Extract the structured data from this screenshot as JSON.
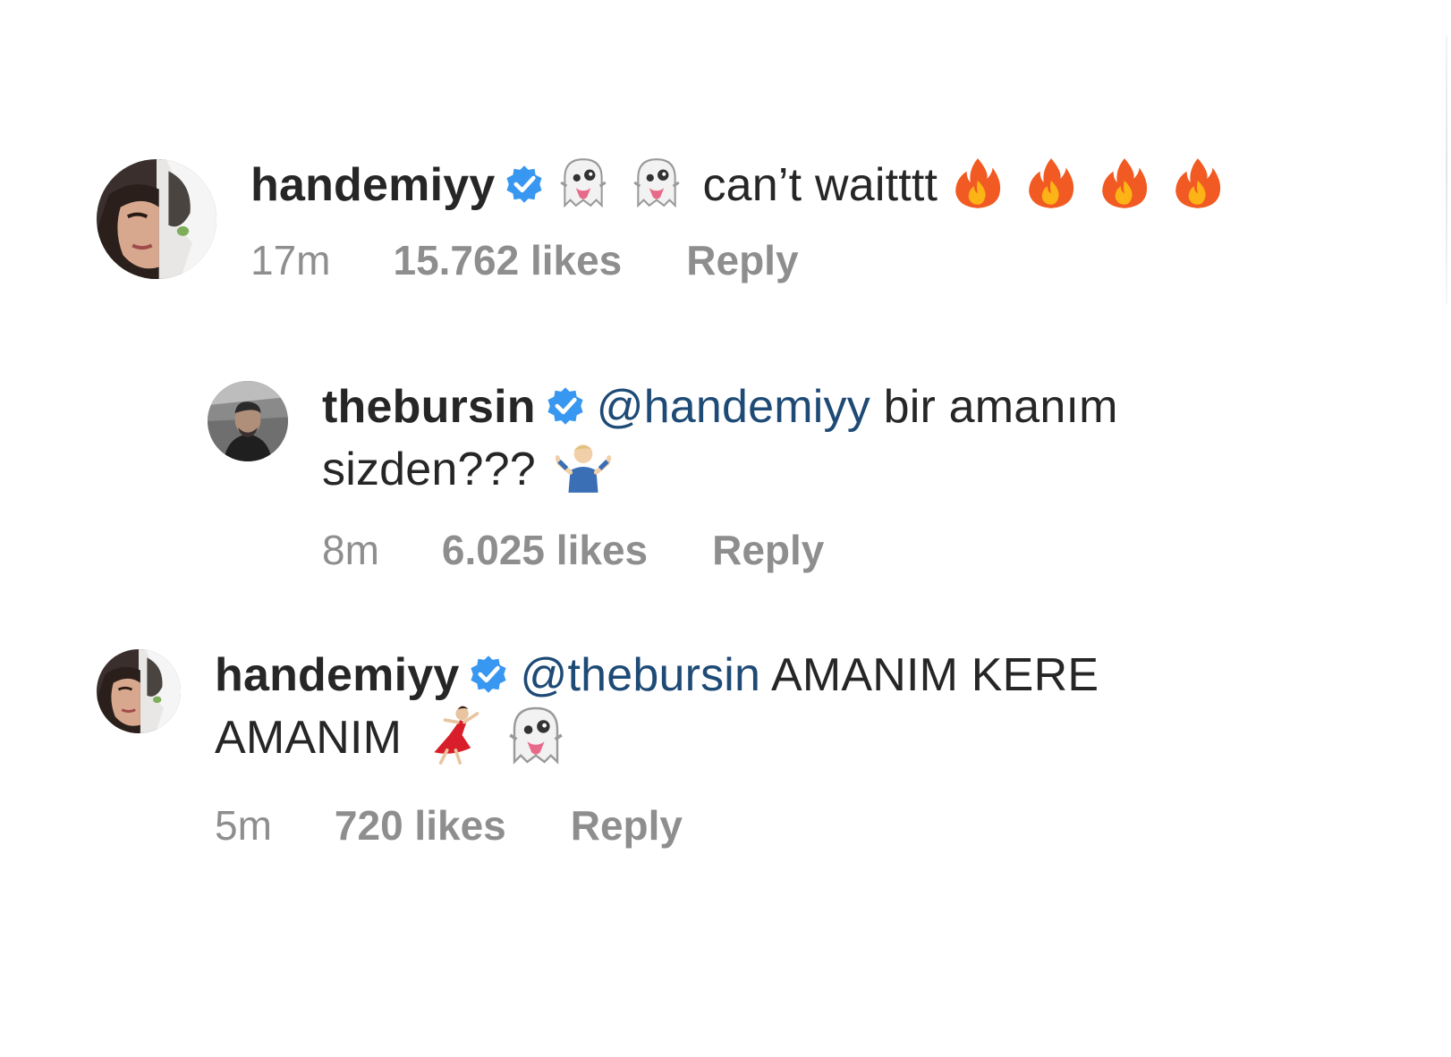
{
  "comments": [
    {
      "username": "handemiyy",
      "verified": true,
      "mention": "",
      "text_line1": "can’t waitttt",
      "text_line2": "",
      "emojis_before_text": [
        "ghost-tongue",
        "ghost-tongue"
      ],
      "emojis_after_text": [
        "fire",
        "fire",
        "fire",
        "fire"
      ],
      "time": "17m",
      "likes": "15.762 likes",
      "reply_label": "Reply"
    },
    {
      "username": "thebursin",
      "verified": true,
      "mention": "@handemiyy",
      "text_line1": "bir amanım",
      "text_line2": "sizden???",
      "emojis_line2": [
        "man-shrugging"
      ],
      "time": "8m",
      "likes": "6.025 likes",
      "reply_label": "Reply"
    },
    {
      "username": "handemiyy",
      "verified": true,
      "mention": "@thebursin",
      "text_line1": "AMANIM KERE",
      "text_line2": "AMANIM",
      "emojis_line2": [
        "woman-dancing",
        "ghost-tongue"
      ],
      "time": "5m",
      "likes": "720 likes",
      "reply_label": "Reply"
    }
  ],
  "colors": {
    "text": "#262626",
    "meta": "#8e8e8e",
    "mention": "#1e4a76",
    "verified": "#3897f0"
  }
}
